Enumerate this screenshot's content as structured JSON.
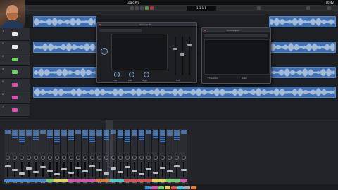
{
  "menubar": {
    "title": "Logic Pro",
    "clock": "10:42"
  },
  "controlbar": {
    "lcd": "1 1 1 1"
  },
  "tracks": [
    {
      "num": "1",
      "color": "#e9e9e9"
    },
    {
      "num": "2",
      "color": "#e9e9e9"
    },
    {
      "num": "3",
      "color": "#69d35a"
    },
    {
      "num": "4",
      "color": "#69d35a"
    },
    {
      "num": "5",
      "color": "#e04fb0"
    },
    {
      "num": "6",
      "color": "#e04fb0"
    },
    {
      "num": "7",
      "color": "#e04fb0"
    }
  ],
  "plugin1": {
    "title": "Channel EQ",
    "labels": [
      "Low",
      "Mid",
      "High",
      "Out"
    ]
  },
  "plugin2": {
    "title": "Compressor",
    "labels": [
      "Threshold",
      "Ratio"
    ]
  },
  "mixer": {
    "strips": [
      {
        "label": "Kick",
        "color": "#3a8de0"
      },
      {
        "label": "Snare",
        "color": "#3a8de0"
      },
      {
        "label": "Hat",
        "color": "#3a8de0"
      },
      {
        "label": "Tom",
        "color": "#3a8de0"
      },
      {
        "label": "OH",
        "color": "#3a8de0"
      },
      {
        "label": "Room",
        "color": "#3a8de0"
      },
      {
        "label": "Bass",
        "color": "#69d35a"
      },
      {
        "label": "Gtr",
        "color": "#e4d64a"
      },
      {
        "label": "Gtr2",
        "color": "#e4d64a"
      },
      {
        "label": "Keys",
        "color": "#e04fb0"
      },
      {
        "label": "Vox",
        "color": "#e04fb0"
      },
      {
        "label": "Vox2",
        "color": "#e04fb0"
      },
      {
        "label": "BV",
        "color": "#e04fb0"
      },
      {
        "label": "Bus",
        "color": "#e77a2e"
      },
      {
        "label": "FX",
        "color": "#e77a2e"
      },
      {
        "label": "Rev",
        "color": "#3fd0c9"
      },
      {
        "label": "Dly",
        "color": "#3fd0c9"
      },
      {
        "label": "Aux",
        "color": "#e94a4a"
      },
      {
        "label": "Aux2",
        "color": "#e94a4a"
      },
      {
        "label": "Mst",
        "color": "#e94a4a"
      },
      {
        "label": "Out",
        "color": "#e94a4a"
      },
      {
        "label": "Out2",
        "color": "#e4d64a"
      },
      {
        "label": "Mon",
        "color": "#e4d64a"
      },
      {
        "label": "Mix",
        "color": "#69d35a"
      },
      {
        "label": "Stem",
        "color": "#69d35a"
      },
      {
        "label": "Ref",
        "color": "#e04fb0"
      }
    ]
  }
}
